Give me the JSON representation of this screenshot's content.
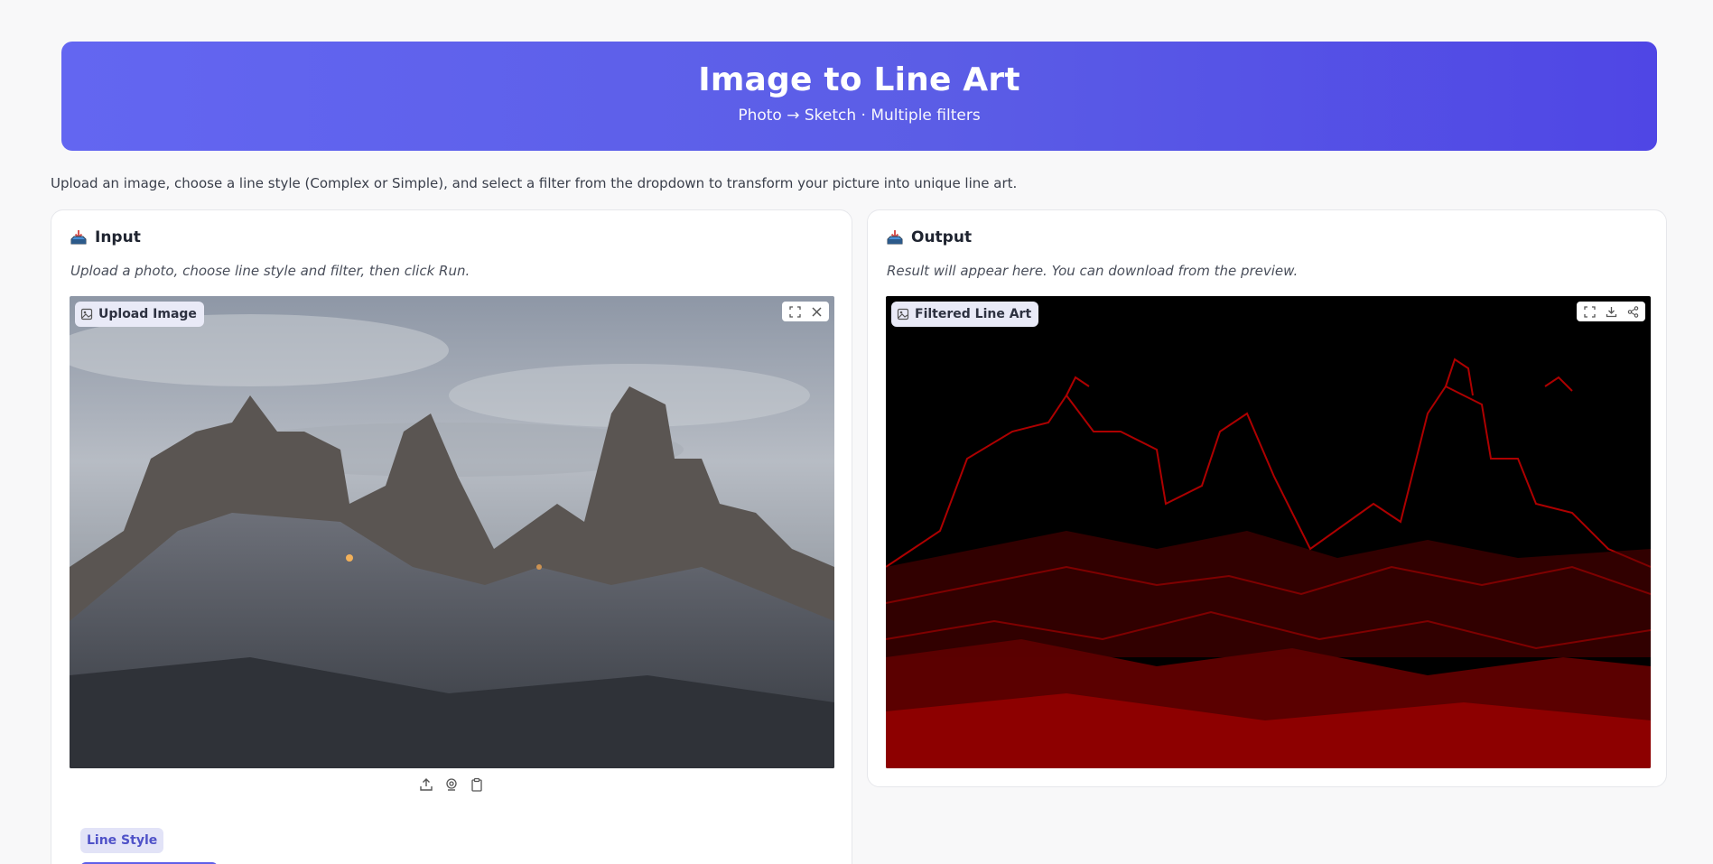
{
  "header": {
    "title": "Image to Line Art",
    "subtitle": "Photo → Sketch · Multiple filters"
  },
  "description": "Upload an image, choose a line style (Complex or Simple), and select a filter from the dropdown to transform your picture into unique line art.",
  "input_panel": {
    "title": "Input",
    "subtitle": "Upload a photo, choose line style and filter, then click Run.",
    "image_label": "Upload Image",
    "tools": [
      "fullscreen-icon",
      "close-icon"
    ],
    "source_icons": [
      "upload-icon",
      "webcam-icon",
      "clipboard-icon"
    ],
    "line_style_label": "Line Style"
  },
  "output_panel": {
    "title": "Output",
    "subtitle": "Result will appear here. You can download from the preview.",
    "image_label": "Filtered Line Art",
    "tools": [
      "fullscreen-icon",
      "download-icon",
      "share-icon"
    ]
  },
  "colors": {
    "header_start": "#6366f1",
    "header_end": "#4f46e5",
    "accent": "#5f5fe8",
    "line_art_red": "#c00000"
  }
}
